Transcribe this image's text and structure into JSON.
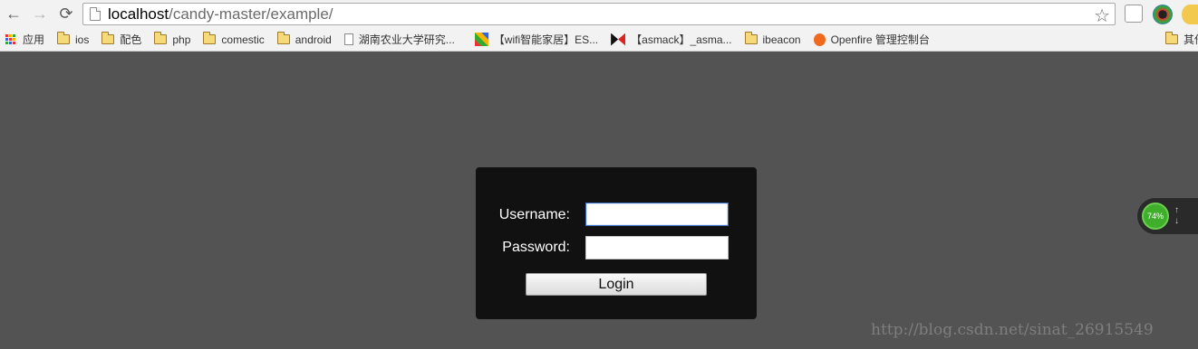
{
  "browser": {
    "nav": {
      "back_icon": "←",
      "forward_icon": "→",
      "reload_icon": "⟳"
    },
    "url": {
      "host": "localhost",
      "path": "/candy-master/example/"
    },
    "star_icon": "☆"
  },
  "bookmarks": [
    {
      "label": "应用",
      "icon": "apps"
    },
    {
      "label": "ios",
      "icon": "folder"
    },
    {
      "label": "配色",
      "icon": "folder"
    },
    {
      "label": "php",
      "icon": "folder"
    },
    {
      "label": "comestic",
      "icon": "folder"
    },
    {
      "label": "android",
      "icon": "folder"
    },
    {
      "label": "湖南农业大学研究...",
      "icon": "page"
    },
    {
      "label": "【wifi智能家居】ES...",
      "icon": "site"
    },
    {
      "label": "【asmack】_asma...",
      "icon": "site"
    },
    {
      "label": "ibeacon",
      "icon": "folder"
    },
    {
      "label": "Openfire 管理控制台",
      "icon": "site"
    },
    {
      "label": "其他",
      "icon": "folder"
    }
  ],
  "login": {
    "username_label": "Username:",
    "password_label": "Password:",
    "username_value": "",
    "password_value": "",
    "login_button": "Login"
  },
  "widget": {
    "percent": "74%"
  },
  "watermark": "http://blog.csdn.net/sinat_26915549",
  "colors": {
    "page_bg": "#535353",
    "box_bg": "#111111",
    "focus_border": "#3b6fc7",
    "badge_green": "#3fae2b"
  }
}
